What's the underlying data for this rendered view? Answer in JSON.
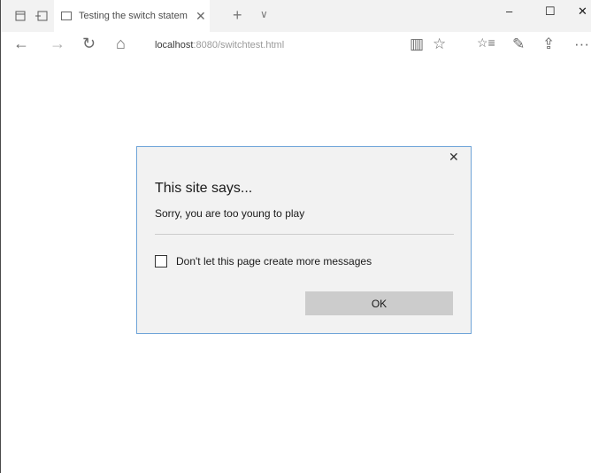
{
  "browser": {
    "tab_title": "Testing the switch statem",
    "tab_close": "✕",
    "new_tab": "+",
    "tab_menu": "∨",
    "window_controls": {
      "minimize": "–",
      "maximize": "☐",
      "close": "✕"
    },
    "nav": {
      "back": "←",
      "forward": "→",
      "refresh": "↻",
      "home": "⌂"
    },
    "address": {
      "host": "localhost",
      "rest": ":8080/switchtest.html"
    },
    "toolbar_right": {
      "reading_view": "▥",
      "favorite": "☆",
      "favorites_hub": "☆≡",
      "notes": "✎",
      "share": "⇪",
      "more": "···"
    }
  },
  "dialog": {
    "close": "✕",
    "title": "This site says...",
    "message": "Sorry, you are too young to play",
    "checkbox_label": "Don't let this page create more messages",
    "checkbox_checked": false,
    "ok_label": "OK"
  }
}
